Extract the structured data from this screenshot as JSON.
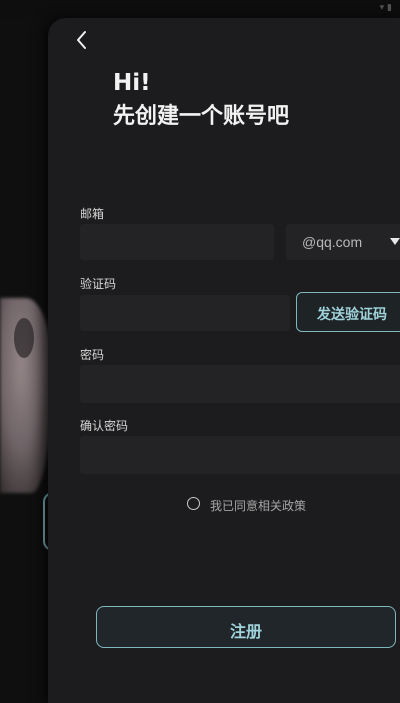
{
  "greeting": {
    "line1": "Hi!",
    "line2": "先创建一个账号吧"
  },
  "form": {
    "email": {
      "label": "邮箱",
      "value": "",
      "placeholder": ""
    },
    "domain": {
      "selected": "@qq.com"
    },
    "code": {
      "label": "验证码",
      "value": "",
      "placeholder": "",
      "send_label": "发送验证码"
    },
    "password": {
      "label": "密码",
      "value": "",
      "placeholder": ""
    },
    "confirm": {
      "label": "确认密码",
      "value": "",
      "placeholder": ""
    }
  },
  "agreement": {
    "text": "我已同意相关政策",
    "checked": false
  },
  "register": {
    "label": "注册"
  },
  "icons": {
    "back": "chevron-left-icon",
    "dropdown": "caret-down-icon",
    "radio": "radio-unchecked-icon"
  },
  "colors": {
    "accent": "#7fb7bf",
    "background": "#1c1c1e",
    "field": "#232326"
  }
}
